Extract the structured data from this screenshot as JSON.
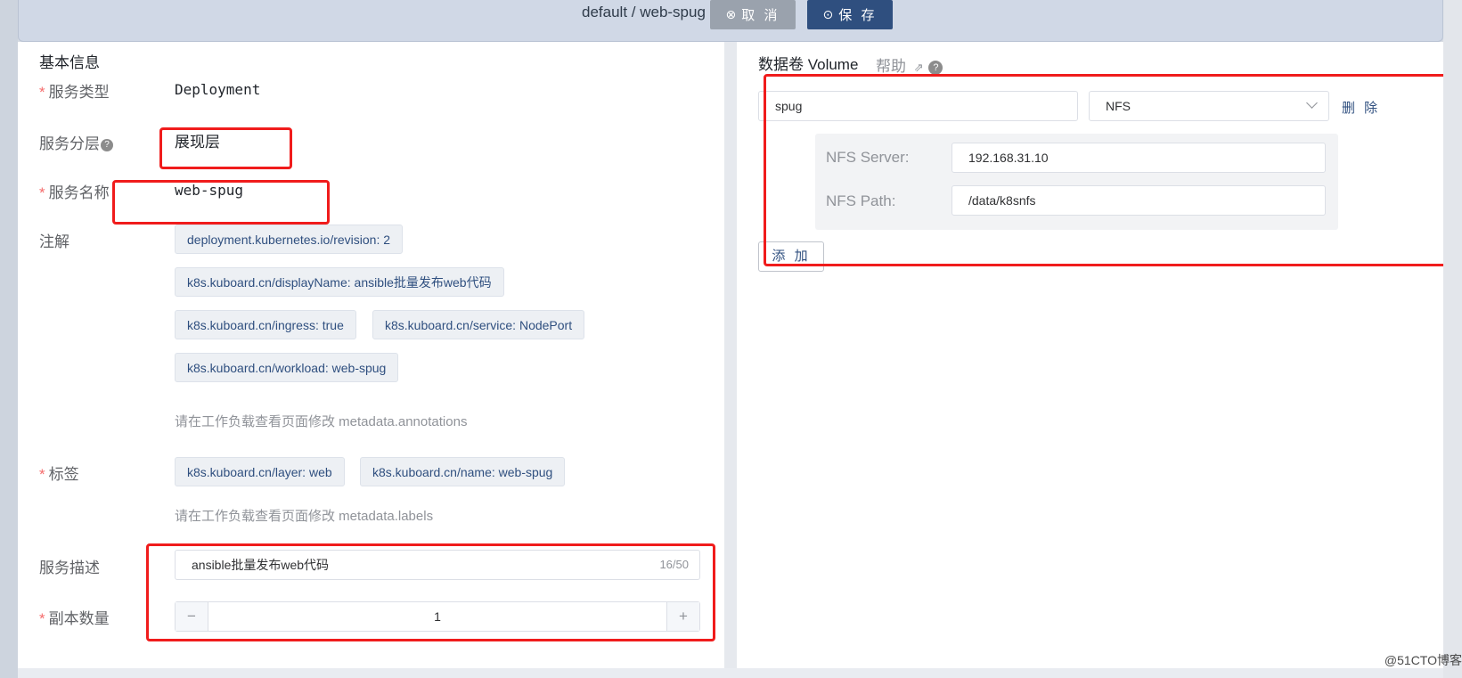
{
  "header": {
    "title": "default / web-spug",
    "cancel_label": "取 消",
    "save_label": "保 存"
  },
  "basic_info": {
    "section_title": "基本信息",
    "service_type": {
      "label": "服务类型",
      "value": "Deployment"
    },
    "service_layer": {
      "label": "服务分层",
      "value": "展现层"
    },
    "service_name": {
      "label": "服务名称",
      "value": "web-spug"
    },
    "annotations": {
      "label": "注解",
      "tags": [
        "deployment.kubernetes.io/revision: 2",
        "k8s.kuboard.cn/displayName: ansible批量发布web代码",
        "k8s.kuboard.cn/ingress: true",
        "k8s.kuboard.cn/service: NodePort",
        "k8s.kuboard.cn/workload: web-spug"
      ],
      "hint": "请在工作负载查看页面修改 metadata.annotations"
    },
    "labels": {
      "label": "标签",
      "tags": [
        "k8s.kuboard.cn/layer: web",
        "k8s.kuboard.cn/name: web-spug"
      ],
      "hint": "请在工作负载查看页面修改 metadata.labels"
    },
    "description": {
      "label": "服务描述",
      "value": "ansible批量发布web代码",
      "counter": "16/50"
    },
    "replicas": {
      "label": "副本数量",
      "value": "1",
      "minus": "−",
      "plus": "+"
    }
  },
  "volume": {
    "section_title": "数据卷 Volume",
    "help_label": "帮助",
    "name_value": "spug",
    "type_value": "NFS",
    "delete_label": "删 除",
    "nfs_server_label": "NFS Server:",
    "nfs_server_value": "192.168.31.10",
    "nfs_path_label": "NFS Path:",
    "nfs_path_value": "/data/k8snfs",
    "add_label": "添 加"
  },
  "watermark": "@51CTO博客",
  "colors": {
    "accent": "#2f4f7f",
    "required": "#f56c6c",
    "highlight_box": "#f01c1c"
  }
}
